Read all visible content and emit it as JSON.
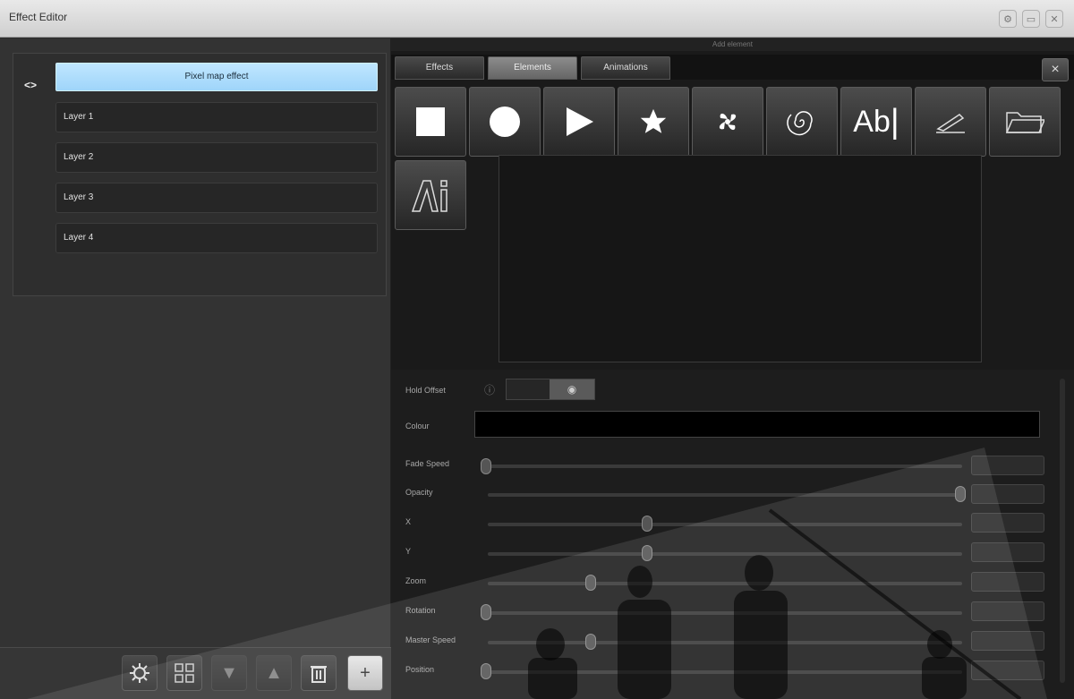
{
  "window": {
    "title": "Effect Editor",
    "buttons": [
      "gear-icon",
      "minimize-icon",
      "close-icon"
    ]
  },
  "layers": {
    "effect_name": "Pixel map effect",
    "items": [
      {
        "label": "Layer 1"
      },
      {
        "label": "Layer 2"
      },
      {
        "label": "Layer 3"
      },
      {
        "label": "Layer 4"
      }
    ]
  },
  "toolbar": {
    "buttons": [
      "settings-icon",
      "grid-icon",
      "down-arrow-icon",
      "up-arrow-icon",
      "trash-icon",
      "plus-icon"
    ],
    "plus_label": "+"
  },
  "right_panel": {
    "header": "Add element",
    "tabs": [
      {
        "label": "Effects",
        "active": false
      },
      {
        "label": "Elements",
        "active": true
      },
      {
        "label": "Animations",
        "active": false
      }
    ],
    "close_label": "×",
    "elements": [
      {
        "icon": "square-icon"
      },
      {
        "icon": "circle-icon"
      },
      {
        "icon": "play-triangle-icon"
      },
      {
        "icon": "star-icon"
      },
      {
        "icon": "fan-icon"
      },
      {
        "icon": "spiral-icon"
      },
      {
        "icon": "text-icon",
        "label": "Ab"
      },
      {
        "icon": "pencil-draw-icon"
      },
      {
        "icon": "folder-icon"
      },
      {
        "icon": "ai-file-icon"
      }
    ]
  },
  "properties": {
    "rows": [
      {
        "label": "Hold Offset"
      },
      {
        "label": "Colour"
      },
      {
        "label": "Fade Speed",
        "level": 0.0
      },
      {
        "label": "Opacity",
        "level": 1.0
      },
      {
        "label": "X",
        "level": 0.34
      },
      {
        "label": "Y",
        "level": 0.34
      },
      {
        "label": "Zoom",
        "level": 0.22
      },
      {
        "label": "Rotation",
        "level": 0.0
      },
      {
        "label": "Master Speed",
        "level": 0.22
      },
      {
        "label": "Position",
        "level": 0.0
      }
    ]
  },
  "colors": {
    "accent": "#a6dbfd",
    "background": "#2b2b2b",
    "panel": "#1a1a1a"
  }
}
